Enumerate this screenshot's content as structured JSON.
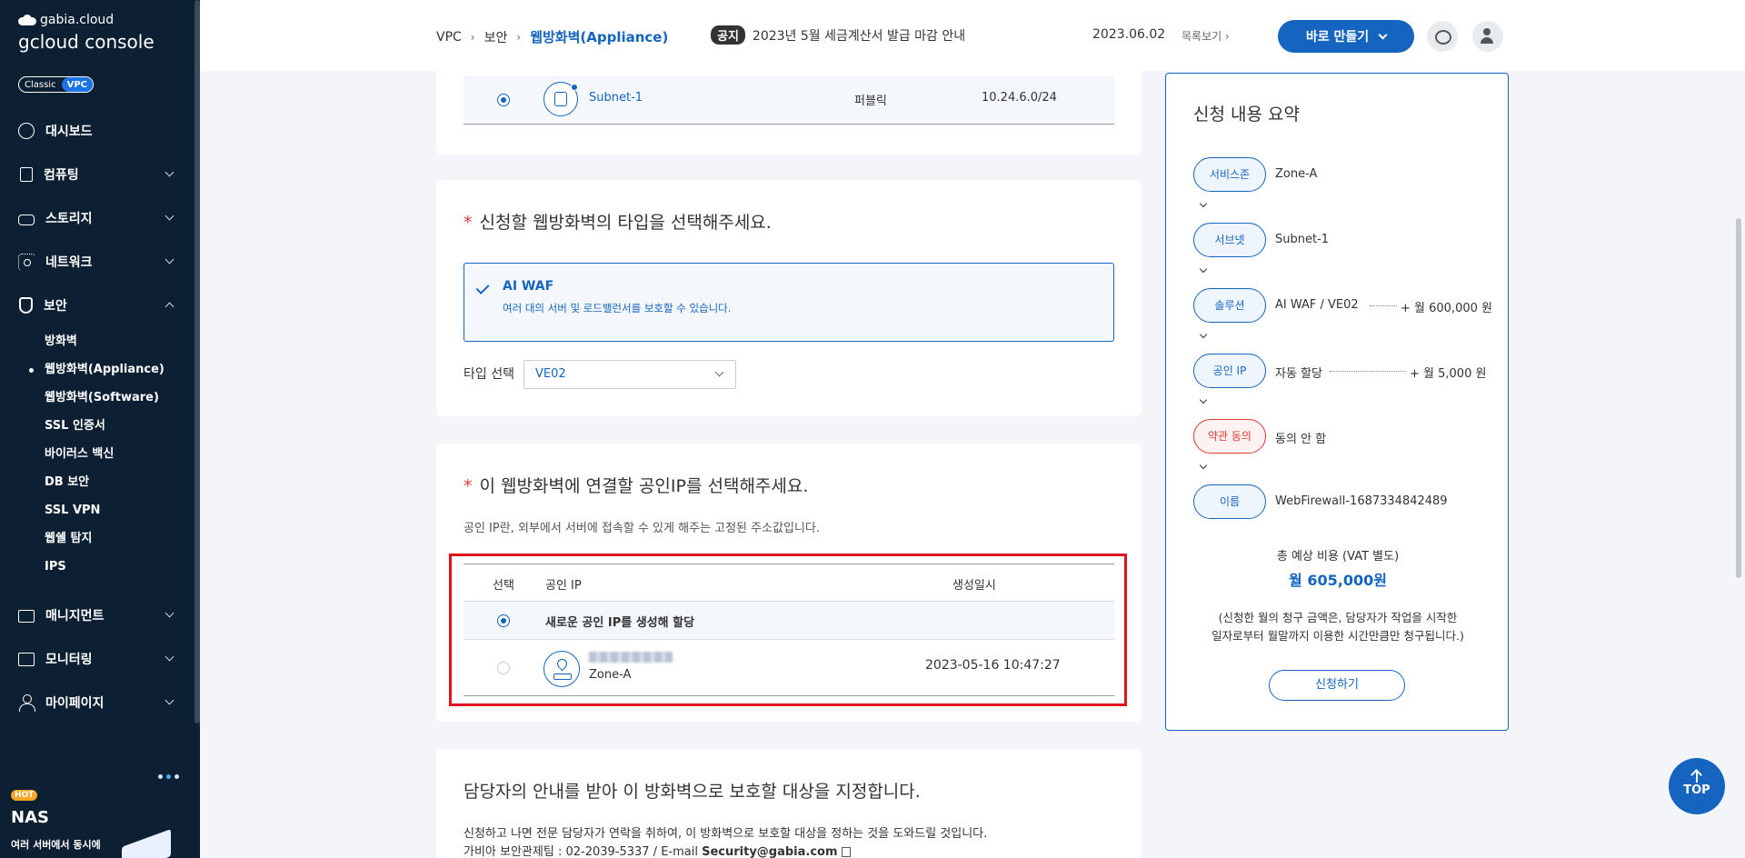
{
  "sidebar": {
    "brand_top": "gabia.cloud",
    "brand_main": "gcloud console",
    "mode_classic": "Classic",
    "mode_vpc": "VPC",
    "items": [
      {
        "label": "대시보드",
        "icon": "dashboard-icon"
      },
      {
        "label": "컴퓨팅",
        "icon": "chip-icon"
      },
      {
        "label": "스토리지",
        "icon": "storage-icon"
      },
      {
        "label": "네트워크",
        "icon": "network-icon"
      },
      {
        "label": "보안",
        "icon": "shield-icon"
      },
      {
        "label": "매니지먼트",
        "icon": "management-icon"
      },
      {
        "label": "모니터링",
        "icon": "monitor-icon"
      },
      {
        "label": "마이페이지",
        "icon": "user-icon"
      }
    ],
    "security_sub": [
      "방화벽",
      "웹방화벽(Appliance)",
      "웹방화벽(Software)",
      "SSL 인증서",
      "바이러스 백신",
      "DB 보안",
      "SSL VPN",
      "웹쉘 탐지",
      "IPS"
    ],
    "promo": {
      "badge": "HOT",
      "title": "NAS",
      "desc": "여러 서버에서 동시에"
    }
  },
  "header": {
    "breadcrumb": [
      "VPC",
      "보안",
      "웹방화벽(Appliance)"
    ],
    "notice_badge": "공지",
    "notice_text": "2023년 5월 세금계산서 발급 마감 안내",
    "notice_date": "2023.06.02",
    "notice_more": "목록보기",
    "create_label": "바로 만들기"
  },
  "subnet": {
    "name": "Subnet-1",
    "type": "퍼블릭",
    "cidr": "10.24.6.0/24"
  },
  "waf_type": {
    "title": "신청할 웹방화벽의 타입을 선택해주세요.",
    "option_title": "AI WAF",
    "option_desc": "여러 대의 서버 및 로드밸런서를 보호할 수 있습니다.",
    "select_label": "타입 선택",
    "select_value": "VE02"
  },
  "public_ip": {
    "title": "이 웹방화벽에 연결할 공인IP를 선택해주세요.",
    "desc": "공인 IP란, 외부에서 서버에 접속할 수 있게 해주는 고정된 주소값입니다.",
    "columns": [
      "선택",
      "공인 IP",
      "생성일시"
    ],
    "new_ip_label": "새로운 공인 IP를 생성해 할당",
    "existing_zone": "Zone-A",
    "existing_date": "2023-05-16 10:47:27"
  },
  "protect": {
    "title": "담당자의 안내를 받아 이 방화벽으로 보호할 대상을 지정합니다.",
    "desc1": "신청하고 나면 전문 담당자가 연락을 취하여, 이 방화벽으로 보호할 대상을 정하는 것을 도와드릴 것입니다.",
    "desc2": "가비아 보안관제팀 : 02-2039-5337 / E-mail ",
    "email": "Security@gabia.com"
  },
  "summary": {
    "title": "신청 내용 요약",
    "steps": [
      {
        "label": "서비스존",
        "value": "Zone-A"
      },
      {
        "label": "서브넷",
        "value": "Subnet-1"
      },
      {
        "label": "솔루션",
        "value": "AI WAF / VE02",
        "price": "+ 월 600,000 원"
      },
      {
        "label": "공인 IP",
        "value": "자동 할당",
        "price": "+ 월 5,000 원"
      },
      {
        "label": "약관 동의",
        "value": "동의 안 함"
      },
      {
        "label": "이름",
        "value": "WebFirewall-1687334842489"
      }
    ],
    "total_label": "총 예상 비용 (VAT 별도)",
    "total": "월 605,000원",
    "note1": "(신청한 월의 청구 금액은, 담당자가 작업을 시작한",
    "note2": "일자로부터 월말까지 이용한 시간만큼만 청구됩니다.)",
    "apply_label": "신청하기"
  },
  "top_button": "TOP",
  "colors": {
    "accent": "#1565c0",
    "sidebar_bg": "#0d1f33",
    "highlight": "#e0141e",
    "warn": "#e53935"
  }
}
